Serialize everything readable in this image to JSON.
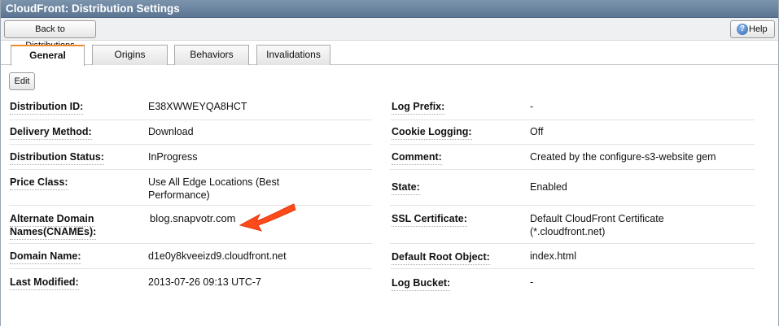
{
  "window": {
    "title": "CloudFront: Distribution Settings"
  },
  "toolbar": {
    "back_label": "Back to Distributions",
    "help_label": "Help"
  },
  "tabs": [
    {
      "label": "General",
      "active": true
    },
    {
      "label": "Origins",
      "active": false
    },
    {
      "label": "Behaviors",
      "active": false
    },
    {
      "label": "Invalidations",
      "active": false
    }
  ],
  "general": {
    "edit_label": "Edit",
    "left": [
      {
        "label": "Distribution ID:",
        "value": "E38XWWEYQA8HCT"
      },
      {
        "label": "Delivery Method:",
        "value": "Download"
      },
      {
        "label": "Distribution Status:",
        "value": "InProgress"
      },
      {
        "label": "Price Class:",
        "value": "Use All Edge Locations (Best Performance)"
      },
      {
        "label": "Alternate Domain Names(CNAMEs):",
        "value": "blog.snapvotr.com"
      },
      {
        "label": "Domain Name:",
        "value": "d1e0y8kveeizd9.cloudfront.net"
      },
      {
        "label": "Last Modified:",
        "value": "2013-07-26 09:13 UTC-7"
      }
    ],
    "right": [
      {
        "label": "Log Prefix:",
        "value": "-"
      },
      {
        "label": "Cookie Logging:",
        "value": "Off"
      },
      {
        "label": "Comment:",
        "value": "Created by the configure-s3-website gem"
      },
      {
        "label": "State:",
        "value": "Enabled"
      },
      {
        "label": "SSL Certificate:",
        "value": "Default CloudFront Certificate (*.cloudfront.net)"
      },
      {
        "label": "Default Root Object:",
        "value": "index.html"
      },
      {
        "label": "Log Bucket:",
        "value": "-"
      }
    ]
  },
  "colors": {
    "title_bar": "#5b7592",
    "active_tab_accent": "#f08a24",
    "annotation_arrow": "#ff4a1a"
  },
  "icons": {
    "help": "help-icon",
    "annotation": "arrow-annotation-icon"
  }
}
